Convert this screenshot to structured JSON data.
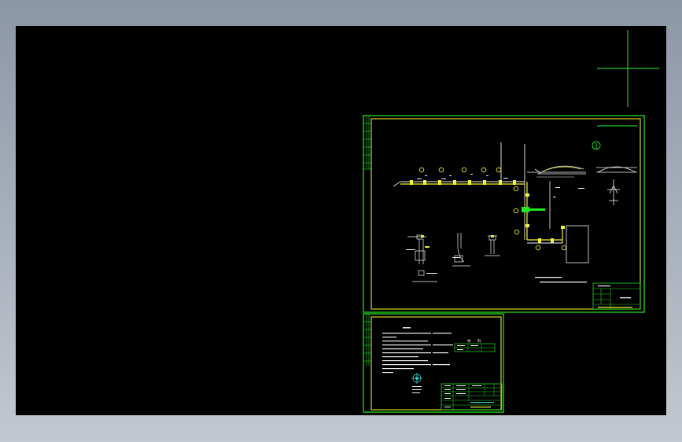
{
  "colors": {
    "background_top": "#8c97a6",
    "background_bottom": "#c3c8d0",
    "viewport": "#000000",
    "sheet_frame": "#1edc1e",
    "sheet_inner": "#e6e62a",
    "linework": "#f0f0f0",
    "accent_line": "#f2f23a",
    "crosshair": "#22c822",
    "cyan": "#35d0d0"
  },
  "drawing": {
    "detail_marker": "1",
    "legend_cell_a": "材",
    "legend_cell_b": "料"
  },
  "icons": {
    "crosshair": "cad-crosshair-cursor",
    "north_arrow": "north-arrow-icon"
  }
}
